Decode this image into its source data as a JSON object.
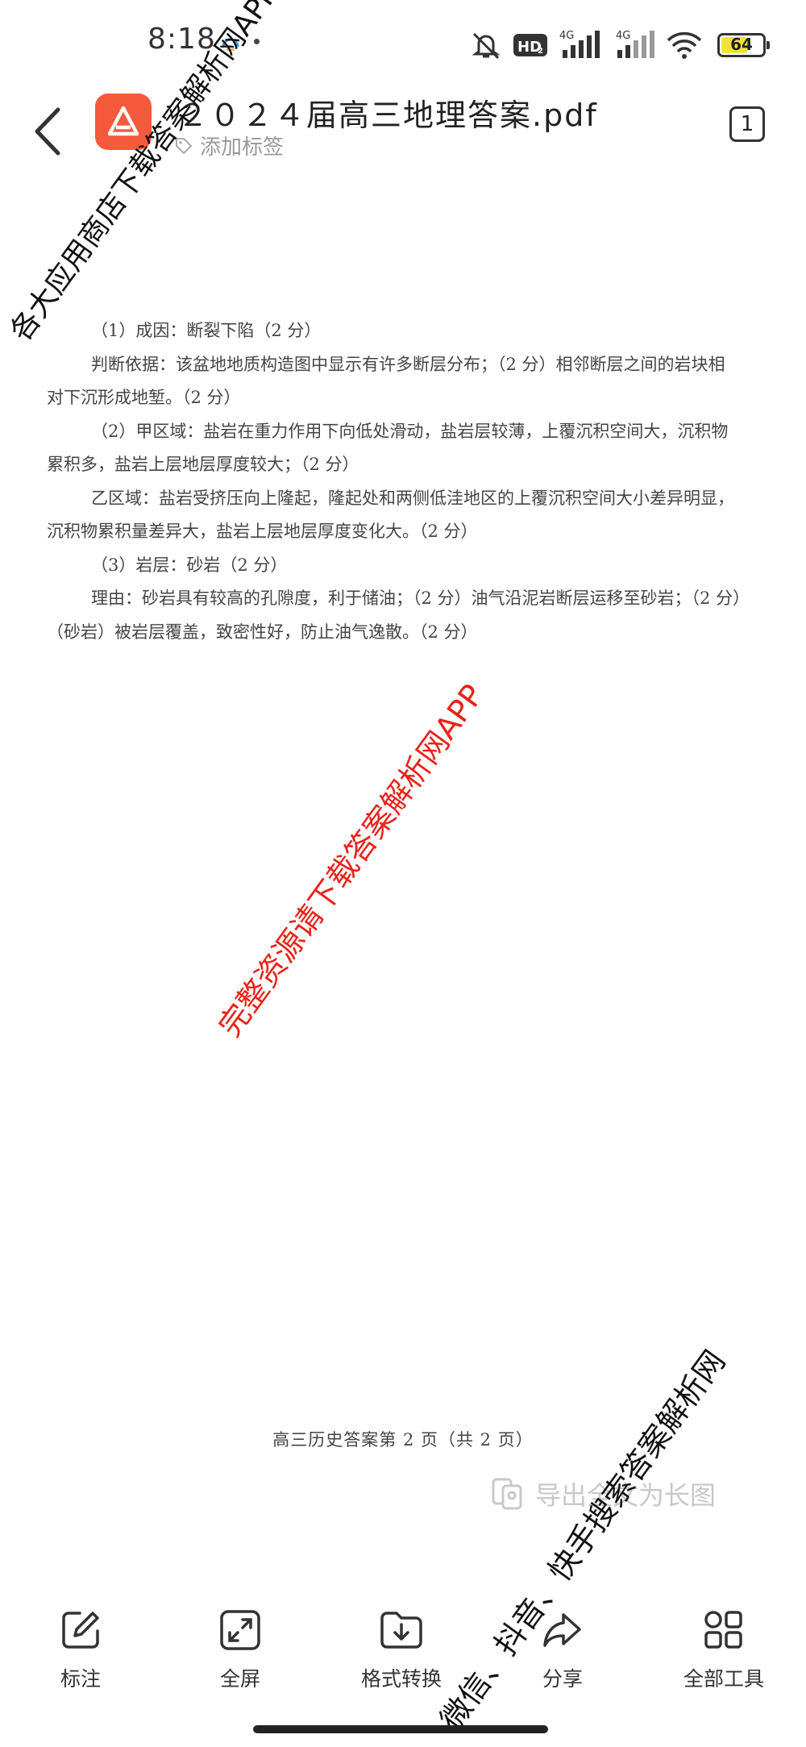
{
  "status_bar": {
    "time": "8:18",
    "battery": "64",
    "battery_level": 0.64,
    "network_1": "4G",
    "network_2": "4G",
    "hd_badge": "HD",
    "icons": [
      "app-notification-icon",
      "mute-icon",
      "hd-icon",
      "signal-icon",
      "wifi-icon",
      "battery-icon"
    ]
  },
  "header": {
    "title": "２０２４届高三地理答案.pdf",
    "tag_placeholder": "添加标签",
    "page_count": "1",
    "brand_color": "#f55a3c"
  },
  "document": {
    "lines": [
      {
        "text": "（1）成因：断裂下陷（2 分）",
        "indent": true
      },
      {
        "text": "判断依据：该盆地地质构造图中显示有许多断层分布；（2 分）相邻断层之间的岩块相",
        "indent": true
      },
      {
        "text": "对下沉形成地堑。（2 分）",
        "indent": false
      },
      {
        "text": "（2）甲区域：盐岩在重力作用下向低处滑动，盐岩层较薄，上覆沉积空间大，沉积物",
        "indent": true
      },
      {
        "text": "累积多，盐岩上层地层厚度较大；（2 分）",
        "indent": false
      },
      {
        "text": "乙区域：盐岩受挤压向上隆起，隆起处和两侧低洼地区的上覆沉积空间大小差异明显，",
        "indent": true
      },
      {
        "text": "沉积物累积量差异大，盐岩上层地层厚度变化大。（2 分）",
        "indent": false
      },
      {
        "text": "（3）岩层：砂岩（2 分）",
        "indent": true
      },
      {
        "text": "理由：砂岩具有较高的孔隙度，利于储油；（2 分）油气沿泥岩断层运移至砂岩；（2 分）",
        "indent": true
      },
      {
        "text": "（砂岩）被岩层覆盖，致密性好，防止油气逸散。（2 分）",
        "indent": false
      }
    ],
    "footer": "高三历史答案第 2 页（共 2 页）"
  },
  "export_hint": "导出全文为长图",
  "watermarks": {
    "top": "各大应用商店下载答案解析网APP",
    "center": "完整资源请下载答案解析网APP",
    "bottom": "微信、抖音、快手搜索答案解析网",
    "center_color": "#e8231a"
  },
  "toolbar": {
    "annotate": "标注",
    "fullscreen": "全屏",
    "convert": "格式转换",
    "share": "分享",
    "all_tools": "全部工具"
  }
}
